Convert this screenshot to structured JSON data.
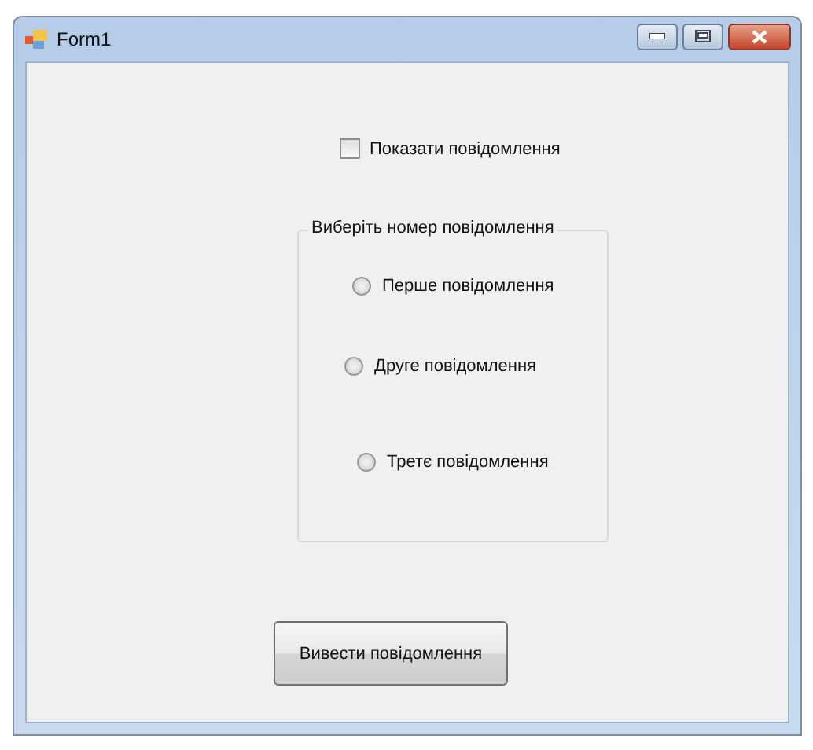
{
  "window": {
    "title": "Form1"
  },
  "checkbox": {
    "label": "Показати повідомлення",
    "checked": false
  },
  "group": {
    "title": "Виберіть номер повідомлення",
    "options": [
      {
        "label": "Перше повідомлення",
        "selected": false
      },
      {
        "label": "Друге повідомлення",
        "selected": false
      },
      {
        "label": "Третє повідомлення",
        "selected": false
      }
    ]
  },
  "button": {
    "label": "Вивести повідомлення"
  }
}
